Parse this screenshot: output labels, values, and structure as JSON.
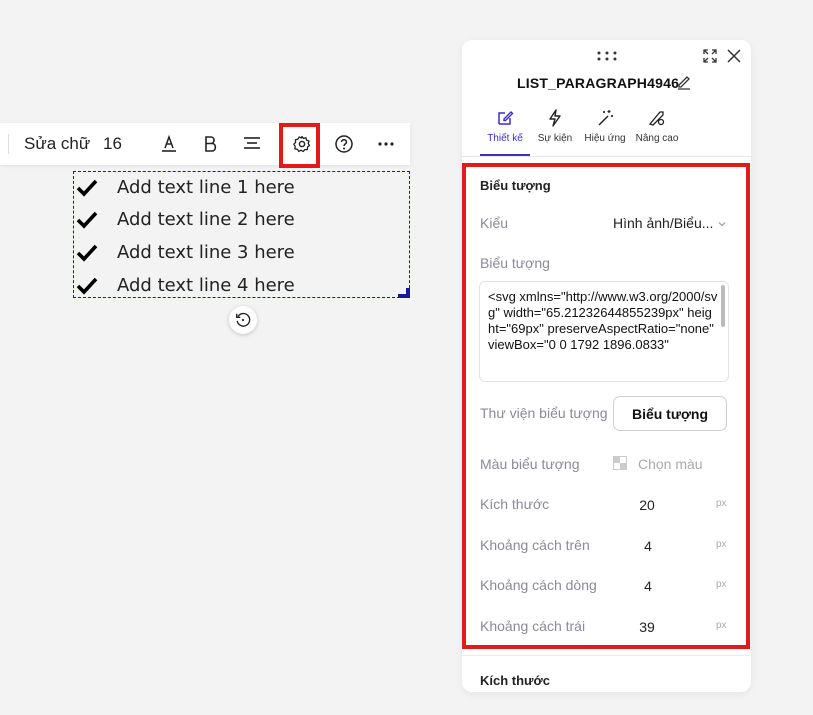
{
  "toolbar": {
    "edit_text_label": "Sửa chữ",
    "font_size": "16",
    "icons": [
      "text-color-icon",
      "bold-icon",
      "align-center-icon",
      "settings-icon",
      "help-icon",
      "more-icon"
    ]
  },
  "canvas": {
    "list_items": [
      {
        "text": "Add text line 1 here"
      },
      {
        "text": "Add text line 2 here"
      },
      {
        "text": "Add text line 3 here"
      },
      {
        "text": "Add text line 4 here"
      }
    ]
  },
  "panel": {
    "title": "LIST_PARAGRAPH4946",
    "tabs": [
      {
        "label": "Thiết kế",
        "active": true
      },
      {
        "label": "Sự kiện",
        "active": false
      },
      {
        "label": "Hiệu ứng",
        "active": false
      },
      {
        "label": "Nâng cao",
        "active": false
      }
    ],
    "icon_section": {
      "heading": "Biểu tượng",
      "type_label": "Kiểu",
      "type_value": "Hình ảnh/Biểu...",
      "icon_label": "Biểu tượng",
      "icon_code": "<svg xmlns=\"http://www.w3.org/2000/svg\" width=\"65.21232644855239px\" height=\"69px\" preserveAspectRatio=\"none\" viewBox=\"0 0 1792 1896.0833\"",
      "library_label": "Thư viện biểu tượng",
      "library_button": "Biểu tượng",
      "color_label": "Màu biểu tượng",
      "color_placeholder": "Chọn màu",
      "size_label": "Kích thước",
      "size_value": "20",
      "top_spacing_label": "Khoảng cách trên",
      "top_spacing_value": "4",
      "line_spacing_label": "Khoảng cách dòng",
      "line_spacing_value": "4",
      "left_spacing_label": "Khoảng cách trái",
      "left_spacing_value": "39",
      "unit": "px"
    },
    "next_section_heading": "Kích thước"
  },
  "colors": {
    "accent": "#3b2fbf",
    "highlight_red": "#e01b1b",
    "selection_border": "#1a1a8c"
  }
}
